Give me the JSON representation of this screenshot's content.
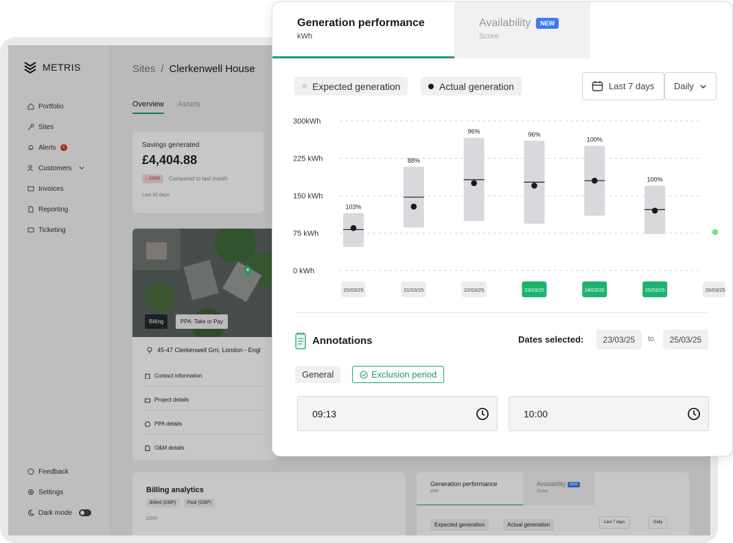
{
  "brand": {
    "name": "METRIS"
  },
  "sidebar": {
    "items": [
      {
        "label": "Portfolio",
        "icon": "home-icon"
      },
      {
        "label": "Sites",
        "icon": "key-icon"
      },
      {
        "label": "Alerts",
        "icon": "bell-icon",
        "badge": "4"
      },
      {
        "label": "Customers",
        "icon": "users-icon"
      },
      {
        "label": "Invoices",
        "icon": "invoice-icon"
      },
      {
        "label": "Reporting",
        "icon": "document-icon"
      },
      {
        "label": "Ticketing",
        "icon": "ticket-icon"
      }
    ],
    "bottom": [
      {
        "label": "Feedback",
        "icon": "chat-icon"
      },
      {
        "label": "Settings",
        "icon": "gear-icon"
      },
      {
        "label": "Dark mode",
        "icon": "moon-icon"
      }
    ]
  },
  "breadcrumb": {
    "root": "Sites",
    "separator": "/",
    "current": "Clerkenwell House"
  },
  "subtabs": {
    "overview": "Overview",
    "assets": "Assets"
  },
  "savings": {
    "label": "Savings generated",
    "amount": "£4,404.88",
    "delta": "↓ £560",
    "compare": "Compared to last month",
    "period": "Last 30 days"
  },
  "site": {
    "tag_billing": "Billing",
    "tag_ppa": "PPA: Take or Pay",
    "address": "45-47 Clerkenwell Grn, London - Engl",
    "details": [
      "Contact information",
      "Project details",
      "PPA details",
      "O&M details"
    ]
  },
  "billing": {
    "title": "Billing analytics",
    "legend": [
      "Billed (GBP)",
      "Paid (GBP)"
    ],
    "y_top": "£2500"
  },
  "small_gen": {
    "tab1_title": "Generation performance",
    "tab1_sub": "kWh",
    "tab2_title": "Availability",
    "tab2_new": "NEW",
    "tab2_sub": "Score",
    "legend_expected": "Expected generation",
    "legend_actual": "Actual generation",
    "range": "Last 7 days",
    "interval": "Daily"
  },
  "panel": {
    "tab1_title": "Generation performance",
    "tab1_sub": "kWh",
    "tab2_title": "Availability",
    "tab2_new": "NEW",
    "tab2_sub": "Score",
    "legend_expected": "Expected generation",
    "legend_actual": "Actual generation",
    "range": "Last 7 days",
    "interval": "Daily"
  },
  "chart_data": {
    "type": "bar",
    "y_ticks": [
      "300kWh",
      "225 kWh",
      "150 kWh",
      "75 kWh",
      "0 kWh"
    ],
    "ylim": [
      0,
      300
    ],
    "categories": [
      "20/03/25",
      "21/03/25",
      "22/03/25",
      "23/03/25",
      "24/03/25",
      "25/03/25",
      "26/03/25"
    ],
    "selected": [
      false,
      false,
      false,
      true,
      true,
      true,
      false
    ],
    "expected_low": [
      47,
      86,
      99,
      94,
      110,
      73,
      null
    ],
    "expected_high": [
      115,
      208,
      266,
      260,
      250,
      170,
      null
    ],
    "expected_mid": [
      82,
      147,
      182,
      177,
      180,
      122,
      null
    ],
    "actual": [
      85,
      128,
      175,
      170,
      180,
      120,
      77
    ],
    "labels": [
      "103%",
      "88%",
      "96%",
      "96%",
      "100%",
      "100%",
      ""
    ],
    "series": [
      {
        "name": "Expected generation",
        "color": "#d9d9dd"
      },
      {
        "name": "Actual generation",
        "color": "#1a1a1a"
      }
    ],
    "highlight_color": "#1bb36e",
    "forecast_point_color": "#7be07b"
  },
  "annotations": {
    "title": "Annotations",
    "dates_label": "Dates selected:",
    "date_from": "23/03/25",
    "to": "to",
    "date_to": "25/03/25",
    "general": "General",
    "exclusion": "Exclusion period",
    "time_from": "09:13",
    "time_to": "10:00"
  }
}
